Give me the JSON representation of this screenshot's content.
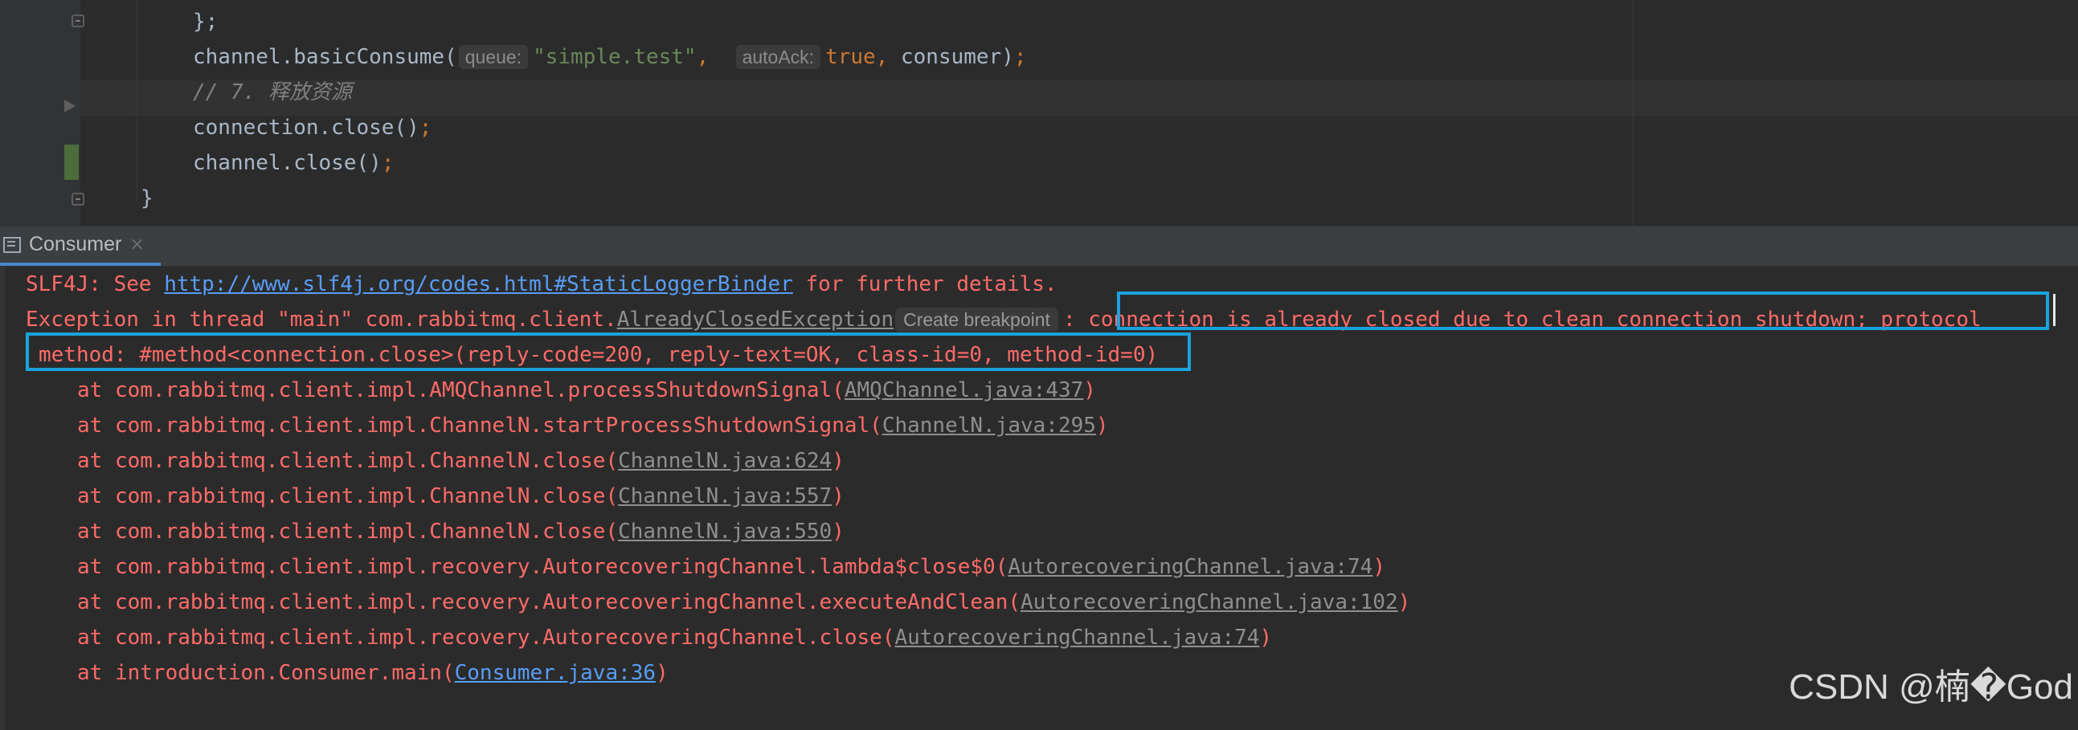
{
  "editor": {
    "lines": {
      "l1": "};",
      "l2_obj": "channel.basicConsume(",
      "l2_hint_queue": "queue:",
      "l2_queue_val": "\"simple.test\"",
      "l2_comma1": ",",
      "l2_hint_autoack": "autoAck:",
      "l2_autoack_val": "true,",
      "l2_tail": " consumer)",
      "l2_semi": ";",
      "l3_comment": "// 7. 释放资源",
      "l4": "connection.close()",
      "l4_semi": ";",
      "l5": "channel.close()",
      "l5_semi": ";",
      "l6": "}"
    }
  },
  "console_tab": {
    "label": "Consumer",
    "close": "×"
  },
  "console": {
    "slf4j_prefix": "SLF4J: See ",
    "slf4j_link": "http://www.slf4j.org/codes.html#StaticLoggerBinder",
    "slf4j_suffix": " for further details.",
    "exc_prefix": "Exception in thread \"main\" com.rabbitmq.client.",
    "exc_class": "AlreadyClosedException",
    "exc_hint": "Create breakpoint",
    "exc_colon": ":",
    "exc_message": " connection is already closed due to clean connection shutdown; protocol",
    "exc_message_2": "method: #method<connection.close>(reply-code=200, reply-text=OK, class-id=0, method-id=0)",
    "stack": [
      {
        "text": "at com.rabbitmq.client.impl.AMQChannel.processShutdownSignal(",
        "link": "AMQChannel.java:437",
        "end": ")"
      },
      {
        "text": "at com.rabbitmq.client.impl.ChannelN.startProcessShutdownSignal(",
        "link": "ChannelN.java:295",
        "end": ")"
      },
      {
        "text": "at com.rabbitmq.client.impl.ChannelN.close(",
        "link": "ChannelN.java:624",
        "end": ")"
      },
      {
        "text": "at com.rabbitmq.client.impl.ChannelN.close(",
        "link": "ChannelN.java:557",
        "end": ")"
      },
      {
        "text": "at com.rabbitmq.client.impl.ChannelN.close(",
        "link": "ChannelN.java:550",
        "end": ")"
      },
      {
        "text": "at com.rabbitmq.client.impl.recovery.AutorecoveringChannel.lambda$close$0(",
        "link": "AutorecoveringChannel.java:74",
        "end": ")"
      },
      {
        "text": "at com.rabbitmq.client.impl.recovery.AutorecoveringChannel.executeAndClean(",
        "link": "AutorecoveringChannel.java:102",
        "end": ")"
      },
      {
        "text": "at com.rabbitmq.client.impl.recovery.AutorecoveringChannel.close(",
        "link": "AutorecoveringChannel.java:74",
        "end": ")"
      },
      {
        "text": "at introduction.Consumer.main(",
        "link": "Consumer.java:36",
        "end": ")"
      }
    ]
  },
  "watermark": "CSDN @楠�God",
  "colors": {
    "background": "#2b2b2b",
    "error_text": "#ff6b68",
    "link_blue": "#589df6",
    "highlight_box": "#1aa2dc",
    "keyword": "#cc7832",
    "string": "#6a8759"
  }
}
